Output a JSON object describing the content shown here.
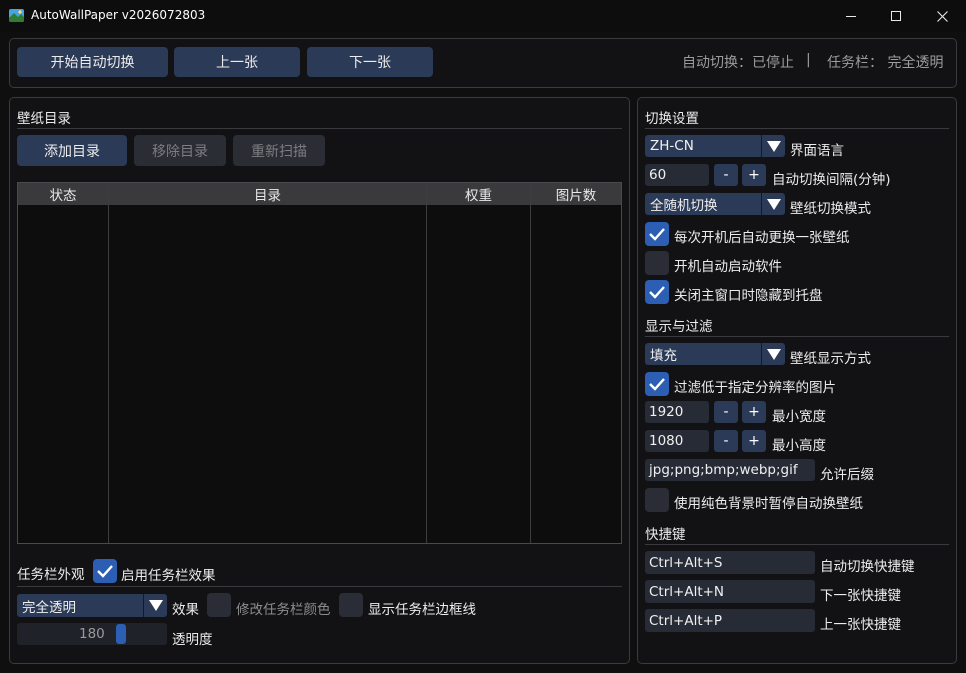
{
  "window": {
    "title": "AutoWallPaper v2026072803"
  },
  "toolbar": {
    "start_label": "开始自动切换",
    "prev_label": "上一张",
    "next_label": "下一张",
    "status_auto": "自动切换：已停止",
    "status_divider": "|",
    "status_taskbar": "任务栏： 完全透明"
  },
  "wallpaper_dirs": {
    "title": "壁纸目录",
    "add_label": "添加目录",
    "remove_label": "移除目录",
    "rescan_label": "重新扫描",
    "columns": [
      "状态",
      "目录",
      "权重",
      "图片数"
    ]
  },
  "taskbar": {
    "title": "任务栏外观",
    "enable_label": "启用任务栏效果",
    "enable_checked": true,
    "effect_value": "完全透明",
    "effect_label": "效果",
    "modify_color_label": "修改任务栏颜色",
    "modify_color_checked": false,
    "show_border_label": "显示任务栏边框线",
    "show_border_checked": false,
    "opacity_value": "180",
    "opacity_fraction": 0.706,
    "opacity_label": "透明度"
  },
  "switch_settings": {
    "title": "切换设置",
    "language_value": "ZH-CN",
    "language_label": "界面语言",
    "interval_value": "60",
    "interval_label": "自动切换间隔(分钟)",
    "mode_value": "全随机切换",
    "mode_label": "壁纸切换模式",
    "change_on_boot_label": "每次开机后自动更换一张壁纸",
    "change_on_boot_checked": true,
    "autostart_label": "开机自动启动软件",
    "autostart_checked": false,
    "hide_to_tray_label": "关闭主窗口时隐藏到托盘",
    "hide_to_tray_checked": true
  },
  "display_filter": {
    "title": "显示与过滤",
    "display_mode_value": "填充",
    "display_mode_label": "壁纸显示方式",
    "filter_low_res_label": "过滤低于指定分辨率的图片",
    "filter_low_res_checked": true,
    "min_width_value": "1920",
    "min_width_label": "最小宽度",
    "min_height_value": "1080",
    "min_height_label": "最小高度",
    "extensions_value": "jpg;png;bmp;webp;gif",
    "extensions_label": "允许后缀",
    "pause_solid_label": "使用纯色背景时暂停自动换壁纸",
    "pause_solid_checked": false
  },
  "hotkeys": {
    "title": "快捷键",
    "auto_switch_value": "Ctrl+Alt+S",
    "auto_switch_label": "自动切换快捷键",
    "next_value": "Ctrl+Alt+N",
    "next_label": "下一张快捷键",
    "prev_value": "Ctrl+Alt+P",
    "prev_label": "上一张快捷键"
  },
  "stepper": {
    "minus": "-",
    "plus": "+"
  },
  "colors": {
    "accent": "#2c5fb3",
    "button": "#2b3a56",
    "background": "#121214"
  },
  "icons": [
    "app-landscape-icon",
    "minimize-icon",
    "maximize-icon",
    "close-icon",
    "dropdown-arrow-icon",
    "check-icon"
  ]
}
